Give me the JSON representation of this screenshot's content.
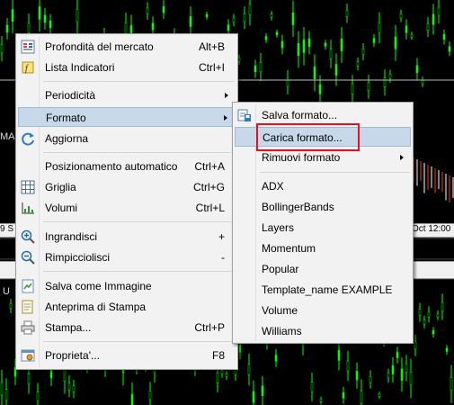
{
  "chart_labels": {
    "left_ma": "MA",
    "left_date": "9 S",
    "right_date": "Oct 12:00",
    "left_u": "U"
  },
  "context_menu": {
    "items": [
      {
        "label": "Profondità del mercato",
        "shortcut": "Alt+B",
        "icon": "market-depth-icon"
      },
      {
        "label": "Lista Indicatori",
        "shortcut": "Ctrl+I",
        "icon": "indicators-list-icon"
      },
      {
        "label": "Periodicità",
        "submenu": true
      },
      {
        "label": "Formato",
        "submenu": true,
        "highlighted": true
      },
      {
        "label": "Aggiorna",
        "icon": "refresh-icon"
      },
      {
        "label": "Posizionamento automatico",
        "shortcut": "Ctrl+A"
      },
      {
        "label": "Griglia",
        "shortcut": "Ctrl+G",
        "icon": "grid-icon"
      },
      {
        "label": "Volumi",
        "shortcut": "Ctrl+L",
        "icon": "volumes-icon"
      },
      {
        "label": "Ingrandisci",
        "shortcut": "+",
        "icon": "zoom-in-icon"
      },
      {
        "label": "Rimpicciolisci",
        "shortcut": "-",
        "icon": "zoom-out-icon"
      },
      {
        "label": "Salva come Immagine",
        "icon": "save-image-icon"
      },
      {
        "label": "Anteprima di Stampa",
        "icon": "print-preview-icon"
      },
      {
        "label": "Stampa...",
        "shortcut": "Ctrl+P",
        "icon": "printer-icon"
      },
      {
        "label": "Proprieta'...",
        "shortcut": "F8",
        "icon": "properties-icon"
      }
    ]
  },
  "formato_submenu": {
    "items": [
      {
        "label": "Salva formato...",
        "icon": "save-template-icon"
      },
      {
        "label": "Carica formato...",
        "highlighted": true
      },
      {
        "label": "Rimuovi formato",
        "submenu": true
      },
      {
        "label": "ADX"
      },
      {
        "label": "BollingerBands"
      },
      {
        "label": "Layers"
      },
      {
        "label": "Momentum"
      },
      {
        "label": "Popular"
      },
      {
        "label": "Template_name EXAMPLE"
      },
      {
        "label": "Volume"
      },
      {
        "label": "Williams"
      }
    ]
  },
  "colors": {
    "candle_up": "#00ff00",
    "candle_down": "#00ff00",
    "highlight": "#c6d8ea",
    "annotation": "#e81123"
  }
}
